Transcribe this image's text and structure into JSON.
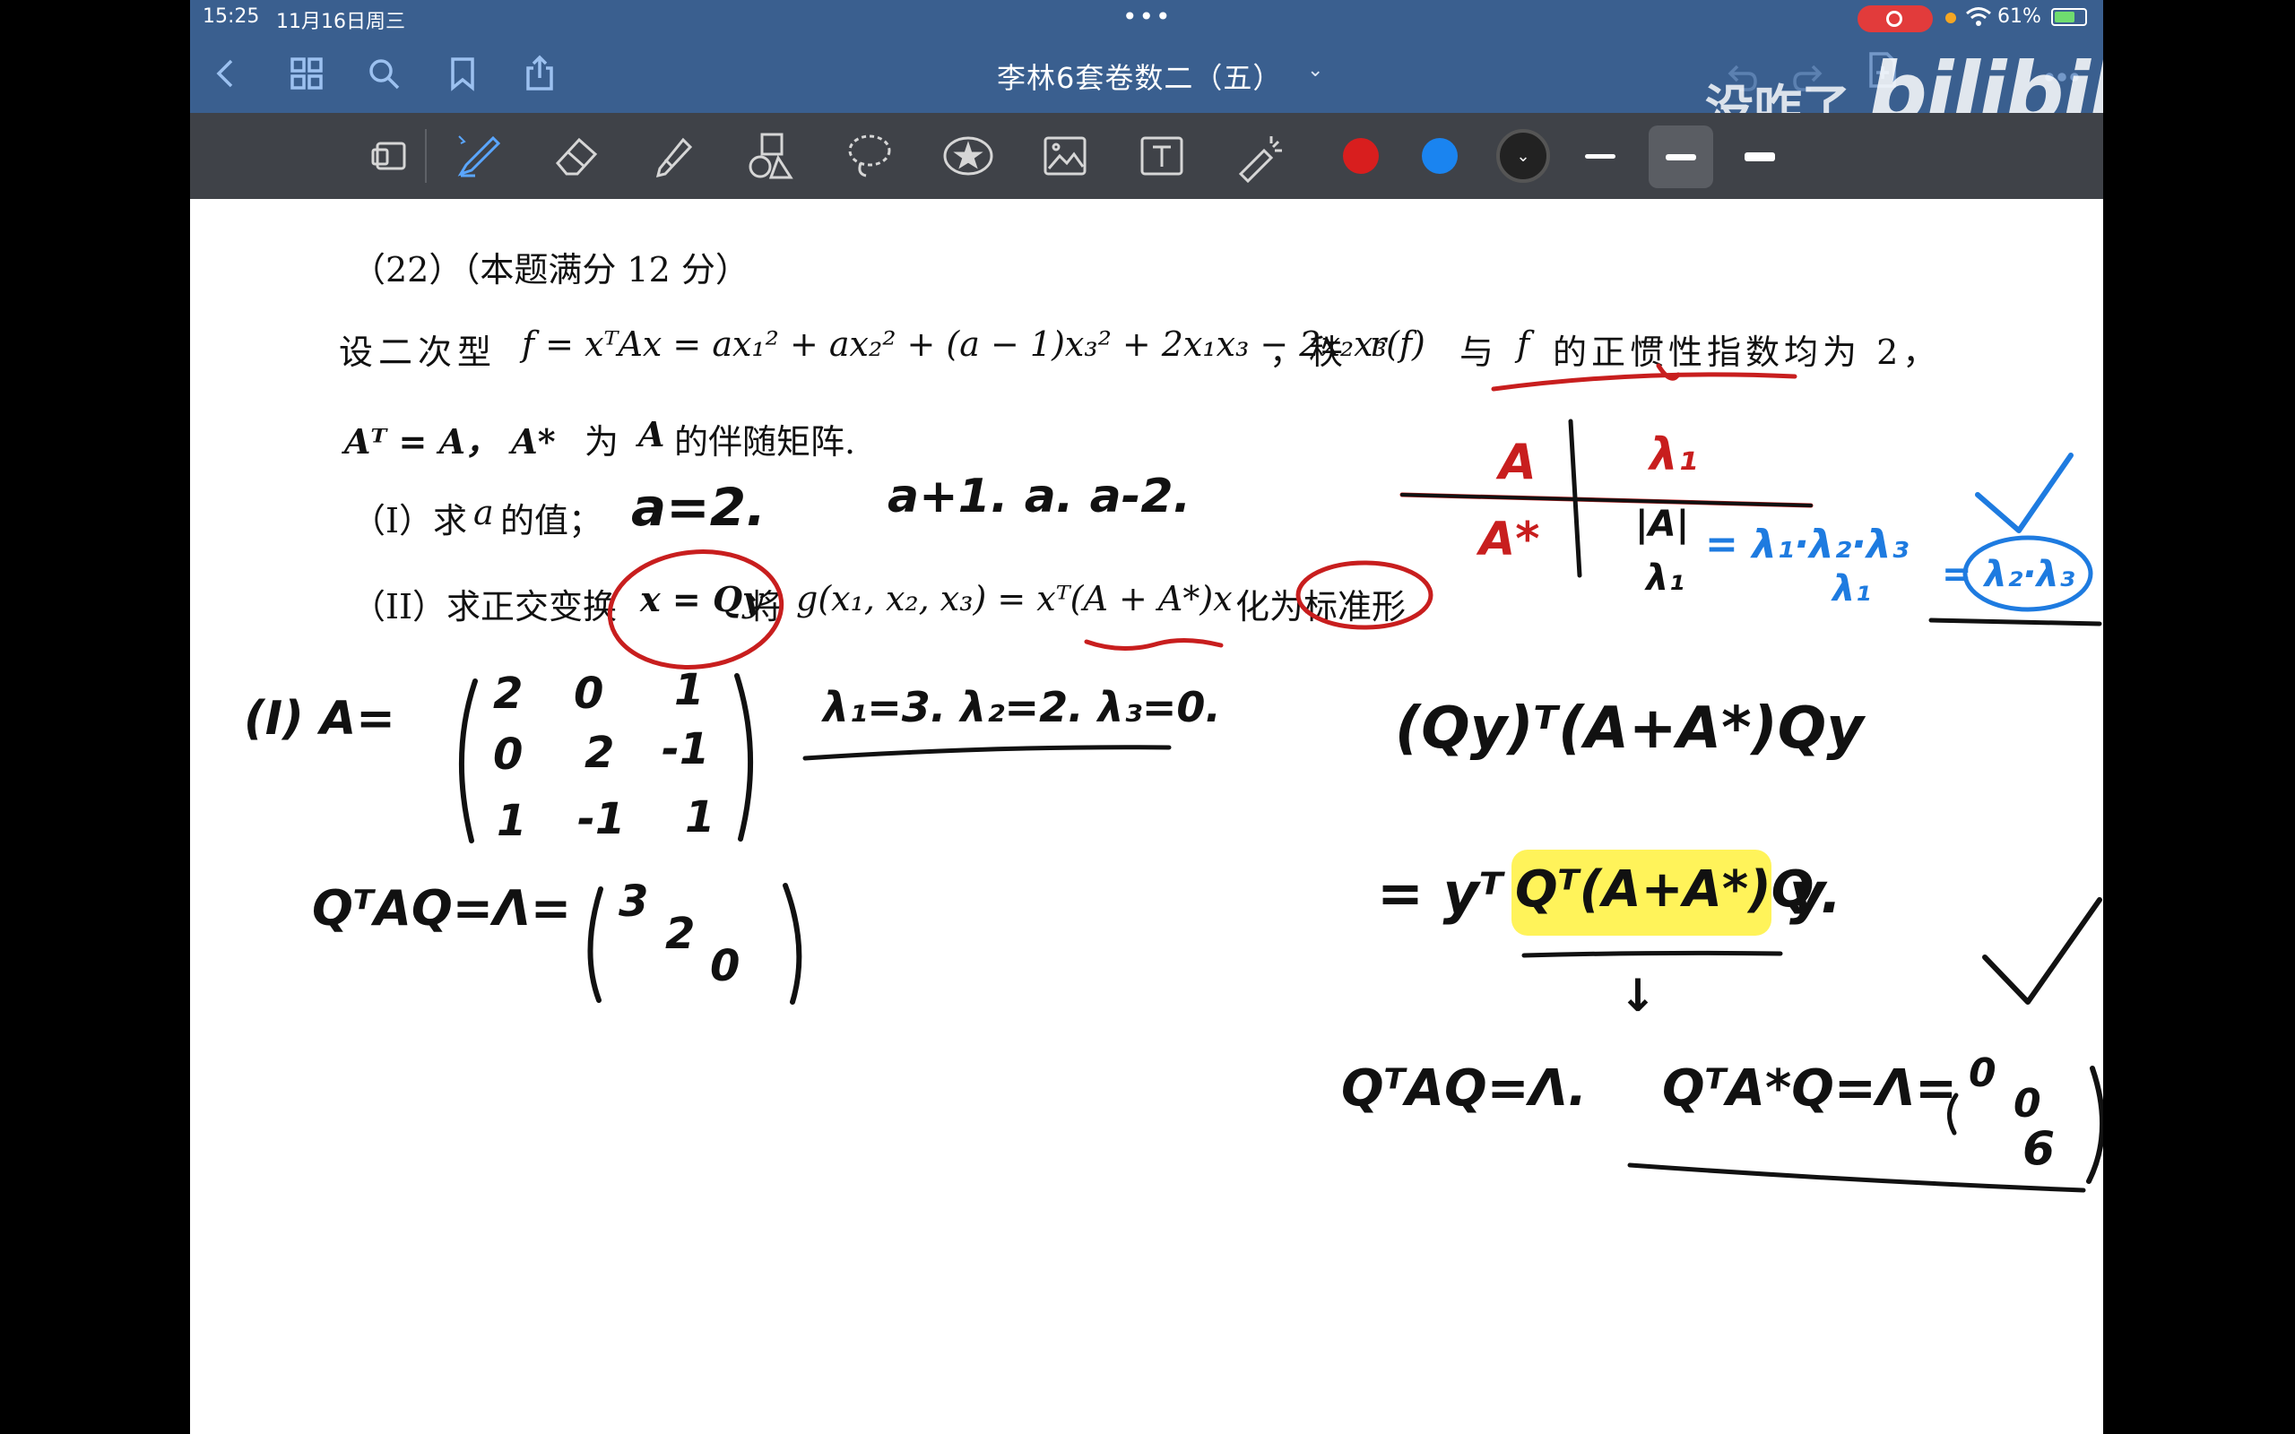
{
  "status": {
    "time": "15:25",
    "date": "11月16日周三",
    "battery": "61%"
  },
  "titlebar": {
    "doc_title": "李林6套卷数二（五）",
    "watermark_text": "没咋了",
    "watermark_logo": "bilibili"
  },
  "toolbar": {
    "colors": [
      "#d81e1e",
      "#1a84f0",
      "#1a1a1a"
    ],
    "icons": [
      "page-select-icon",
      "pen-icon",
      "eraser-icon",
      "highlighter-icon",
      "shapes-icon",
      "lasso-icon",
      "sticker-icon",
      "image-icon",
      "text-box-icon",
      "laser-pointer-icon"
    ]
  },
  "problem": {
    "number": "（22）（本题满分 12 分）",
    "stmt1_a": "设二次型",
    "stmt1_math": "f = xᵀAx = ax₁² + ax₂² + (a − 1)x₃² + 2x₁x₃ − 2x₂x₃",
    "stmt1_b": "，秩",
    "stmt1_r": "r(f)",
    "stmt1_c": "与",
    "stmt1_f": "f",
    "stmt1_d": "的正惯性指数均为 2，",
    "stmt2_math": "Aᵀ = A，  A*",
    "stmt2_a": "为",
    "stmt2_A": "A",
    "stmt2_b": "的伴随矩阵.",
    "part1_a": "（I）求",
    "part1_var": "a",
    "part1_b": "的值；",
    "part2_a": "（II）求正交变换",
    "part2_math1": "x = Qy",
    "part2_b": "将",
    "part2_math2": "g(x₁, x₂, x₃) = xᵀ(A + A*)x",
    "part2_c": "化为标准形"
  },
  "handwriting": {
    "a_eq": "a=2.",
    "eigen_a": "a+1. a. a-2.",
    "table_A": "A",
    "table_Astar": "A*",
    "table_lambda1": "λ₁",
    "table_frac": "|A|",
    "table_frac_den": "λ₁",
    "blue_eq": "= λ₁·λ₂·λ₃",
    "blue_den": "λ₁",
    "blue_res": "= λ₂·λ₃",
    "sol_label": "(I) A=",
    "matrix": [
      [
        "2",
        "0",
        "1"
      ],
      [
        "0",
        "2",
        "-1"
      ],
      [
        "1",
        "-1",
        "1"
      ]
    ],
    "eigenvalues": "λ₁=3. λ₂=2. λ₃=0.",
    "diag_eq": "QᵀAQ=Λ=",
    "diag_vals": [
      "3",
      "2",
      "0"
    ],
    "qy_line": "(Qy)ᵀ(A+A*)Qy",
    "qy_line2_pre": "= yᵀ",
    "qy_line2_mid": "Qᵀ(A+A*)Q",
    "qy_line2_post": "y.",
    "arrow": "↓",
    "bottom_eq1": "QᵀAQ=Λ.",
    "bottom_eq2": "QᵀA*Q=Λ=",
    "bottom_diag": [
      "0",
      "0",
      "6"
    ]
  }
}
